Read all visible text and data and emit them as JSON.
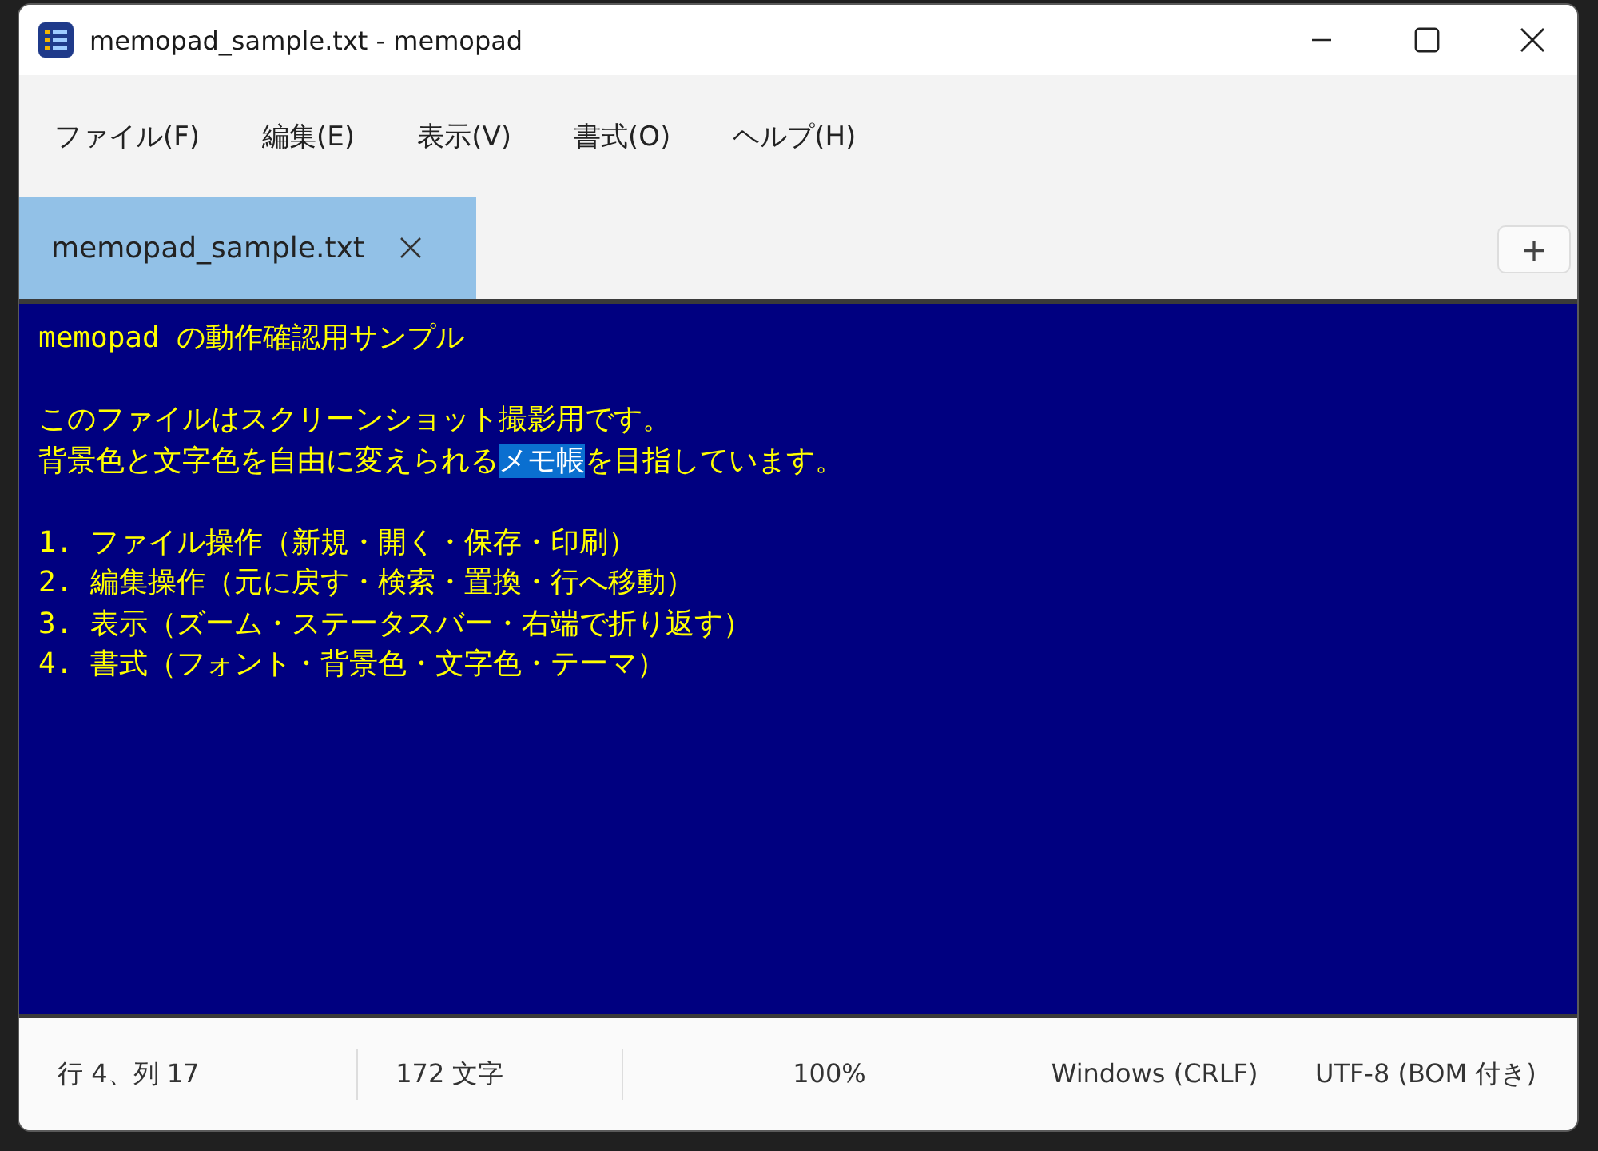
{
  "window": {
    "title": "memopad_sample.txt - memopad"
  },
  "menu": [
    {
      "label": "ファイル(F)"
    },
    {
      "label": "編集(E)"
    },
    {
      "label": "表示(V)"
    },
    {
      "label": "書式(O)"
    },
    {
      "label": "ヘルプ(H)"
    }
  ],
  "tabs": [
    {
      "label": "memopad_sample.txt",
      "selected": true
    }
  ],
  "new_tab_button": "+",
  "editor": {
    "lines": [
      {
        "kind": "text",
        "text": "memopad の動作確認用サンプル"
      },
      {
        "kind": "blank"
      },
      {
        "kind": "text",
        "text": "このファイルはスクリーンショット撮影用です。"
      },
      {
        "kind": "parts",
        "parts": [
          {
            "text": "背景色と文字色を自由に変えられる",
            "selected": false
          },
          {
            "text": "メモ帳",
            "selected": true
          },
          {
            "text": "を目指しています。",
            "selected": false
          }
        ]
      },
      {
        "kind": "blank"
      },
      {
        "kind": "text",
        "text": "1. ファイル操作（新規・開く・保存・印刷）"
      },
      {
        "kind": "text",
        "text": "2. 編集操作（元に戻す・検索・置換・行へ移動）"
      },
      {
        "kind": "text",
        "text": "3. 表示（ズーム・ステータスバー・右端で折り返す）"
      },
      {
        "kind": "text",
        "text": "4. 書式（フォント・背景色・文字色・テーマ）"
      }
    ]
  },
  "status_bar": {
    "position": "行 4、列 17",
    "char_count": "172 文字",
    "zoom": "100%",
    "line_ending": "Windows (CRLF)",
    "encoding": "UTF-8 (BOM 付き)"
  }
}
